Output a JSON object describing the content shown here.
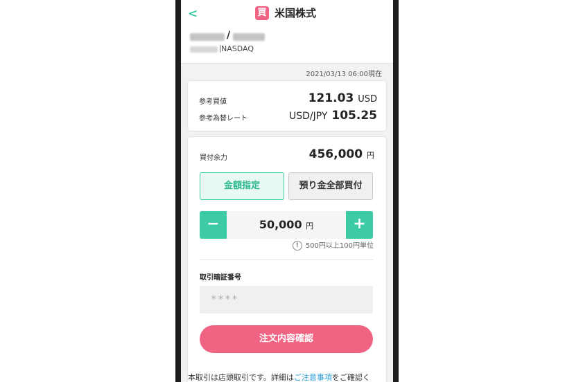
{
  "header": {
    "back_icon": "chevron-left-icon",
    "badge_label": "買",
    "title": "米国株式"
  },
  "stock": {
    "slash": "/",
    "separator": "|",
    "exchange": "NASDAQ"
  },
  "timestamp": "2021/03/13 06:00現在",
  "quote": {
    "ref_price_label": "参考買値",
    "ref_price_value": "121.03",
    "ref_price_unit": "USD",
    "fx_label": "参考為替レート",
    "fx_pair": "USD/JPY",
    "fx_value": "105.25"
  },
  "order": {
    "buying_power_label": "買付余力",
    "buying_power_value": "456,000",
    "buying_power_unit": "円",
    "mode_amount_label": "金額指定",
    "mode_all_label": "預り金全部買付",
    "stepper_minus": "−",
    "stepper_plus": "+",
    "amount_value": "50,000",
    "amount_unit": "円",
    "note_icon": "!",
    "note_text": "500円以上100円単位",
    "pin_label": "取引暗証番号",
    "pin_placeholder": "****",
    "confirm_label": "注文内容確認"
  },
  "footer": {
    "text_before": "本取引は店頭取引です。詳細は",
    "link_text": "ご注意事項",
    "text_after": "をご確認く"
  },
  "colors": {
    "accent_green": "#3ccba5",
    "accent_pink": "#f06383",
    "link_blue": "#2a9fd6"
  }
}
